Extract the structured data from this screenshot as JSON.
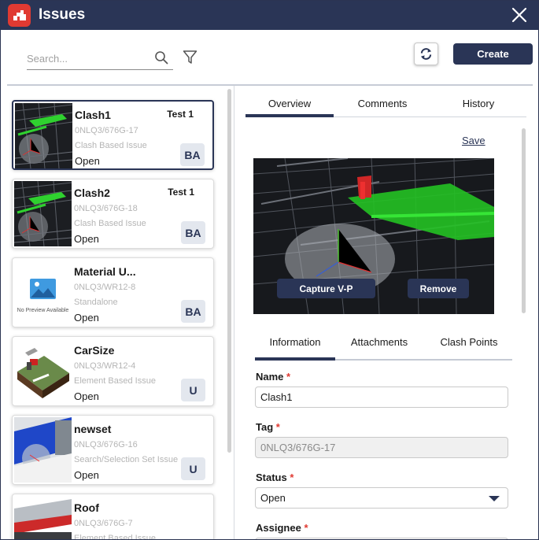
{
  "window": {
    "title": "Issues",
    "app_icon": "revizto-logo-icon",
    "close_icon": "close-icon"
  },
  "toolbar": {
    "search_placeholder": "Search...",
    "search_icon": "search-icon",
    "filter_icon": "filter-icon",
    "sync_icon": "sync-icon",
    "create_label": "Create"
  },
  "issues": [
    {
      "name": "Clash1",
      "right": "Test 1",
      "tag": "0NLQ3/676G-17",
      "type": "Clash Based Issue",
      "status": "Open",
      "badge": "BA",
      "selected": true
    },
    {
      "name": "Clash2",
      "right": "Test 1",
      "tag": "0NLQ3/676G-18",
      "type": "Clash Based Issue",
      "status": "Open",
      "badge": "BA",
      "selected": false
    },
    {
      "name": "Material U...",
      "right": "",
      "tag": "0NLQ3/WR12-8",
      "type": "Standalone",
      "status": "Open",
      "badge": "BA",
      "selected": false,
      "thumb_text": "No Preview Available"
    },
    {
      "name": "CarSize",
      "right": "",
      "tag": "0NLQ3/WR12-4",
      "type": "Element Based Issue",
      "status": "Open",
      "badge": "U",
      "selected": false
    },
    {
      "name": "newset",
      "right": "",
      "tag": "0NLQ3/676G-16",
      "type": "Search/Selection Set Issue",
      "status": "Open",
      "badge": "U",
      "selected": false
    },
    {
      "name": "Roof",
      "right": "",
      "tag": "0NLQ3/676G-7",
      "type": "Element Based Issue",
      "status": "",
      "badge": "",
      "selected": false
    }
  ],
  "detail_tabs": [
    {
      "label": "Overview",
      "active": true
    },
    {
      "label": "Comments",
      "active": false
    },
    {
      "label": "History",
      "active": false
    }
  ],
  "detail": {
    "save_label": "Save",
    "capture_label": "Capture V-P",
    "remove_label": "Remove"
  },
  "sub_tabs": [
    {
      "label": "Information",
      "active": true
    },
    {
      "label": "Attachments",
      "active": false
    },
    {
      "label": "Clash Points",
      "active": false
    }
  ],
  "form": {
    "name_label": "Name",
    "name_value": "Clash1",
    "tag_label": "Tag",
    "tag_value": "0NLQ3/676G-17",
    "status_label": "Status",
    "status_value": "Open",
    "assignee_label": "Assignee",
    "required_mark": "*"
  },
  "colors": {
    "accent": "#2a3556",
    "brand_red": "#e03a32",
    "required": "#e03a32"
  }
}
